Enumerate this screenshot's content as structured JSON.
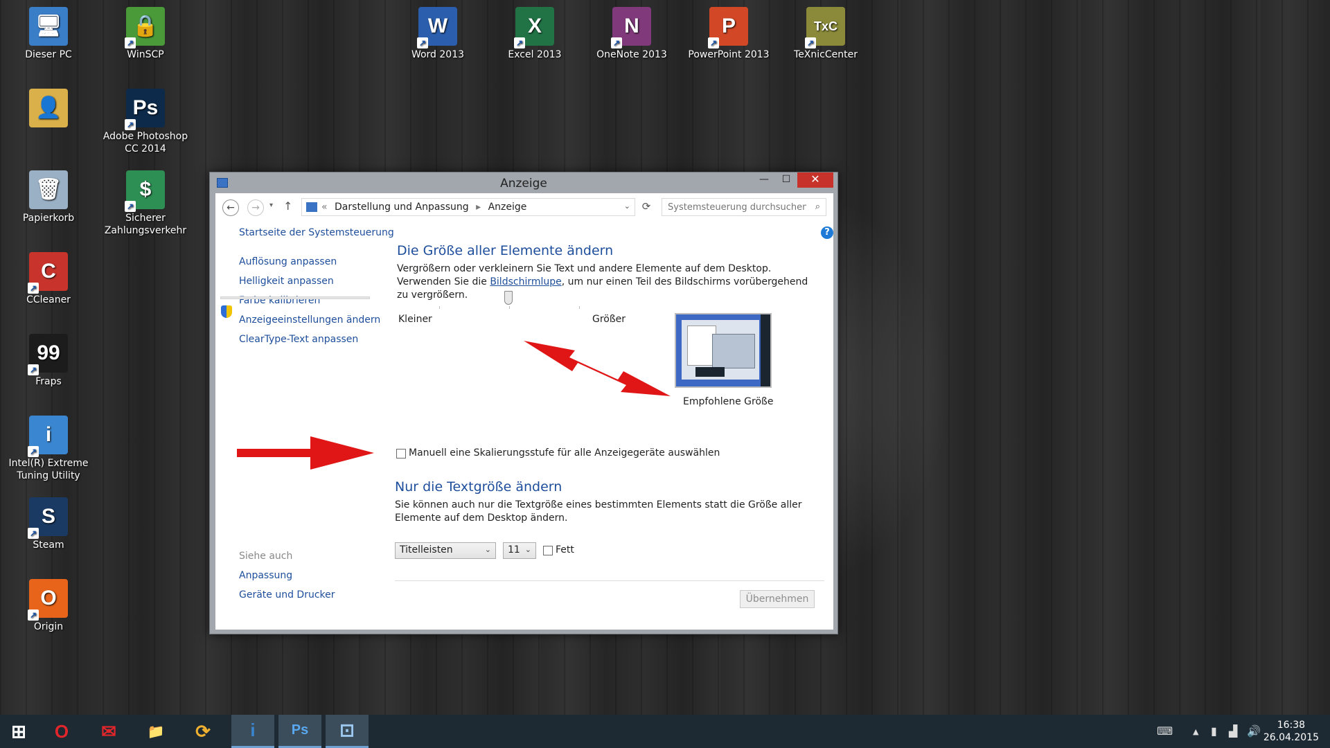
{
  "desktop": {
    "icons": [
      {
        "label": "Dieser PC",
        "glyph": "🖥",
        "color": "#3b7ec8"
      },
      {
        "label": "WinSCP",
        "glyph": "🔒",
        "color": "#4a9a3a"
      },
      {
        "label": "",
        "glyph": "👤",
        "color": "#d9b04a"
      },
      {
        "label": "Adobe Photoshop CC 2014",
        "glyph": "Ps",
        "color": "#0d2a4a"
      },
      {
        "label": "Papierkorb",
        "glyph": "🗑",
        "color": "#9ab0c4"
      },
      {
        "label": "Sicherer Zahlungsverkehr",
        "glyph": "$",
        "color": "#2e8f55"
      },
      {
        "label": "CCleaner",
        "glyph": "C",
        "color": "#c8342c"
      },
      {
        "label": "Fraps",
        "glyph": "99",
        "color": "#1c1c1c"
      },
      {
        "label": "Intel(R) Extreme Tuning Utility",
        "glyph": "i",
        "color": "#3a86d0"
      },
      {
        "label": "Steam",
        "glyph": "S",
        "color": "#1a3a64"
      },
      {
        "label": "Origin",
        "glyph": "O",
        "color": "#e8641a"
      },
      {
        "label": "Word 2013",
        "glyph": "W",
        "color": "#2b5fae"
      },
      {
        "label": "Excel 2013",
        "glyph": "X",
        "color": "#217346"
      },
      {
        "label": "OneNote 2013",
        "glyph": "N",
        "color": "#80397b"
      },
      {
        "label": "PowerPoint 2013",
        "glyph": "P",
        "color": "#d24726"
      },
      {
        "label": "TeXnicCenter",
        "glyph": "TxC",
        "color": "#8a8a3a"
      }
    ]
  },
  "window": {
    "title": "Anzeige",
    "minimize": "—",
    "maximize": "☐",
    "close": "✕",
    "address": {
      "recent": "▾",
      "up": "↑",
      "prefix": "«",
      "crumb1": "Darstellung und Anpassung",
      "crumb_sep": "▸",
      "crumb2": "Anzeige",
      "refresh": "⟳",
      "search_placeholder": "Systemsteuerung durchsuchen"
    },
    "sidebar": {
      "home": "Startseite der Systemsteuerung",
      "items": [
        "Auflösung anpassen",
        "Helligkeit anpassen",
        "Farbe kalibrieren",
        "Anzeigeeinstellungen ändern",
        "ClearType-Text anpassen"
      ],
      "see_also": "Siehe auch",
      "see_also_items": [
        "Anpassung",
        "Geräte und Drucker"
      ]
    },
    "main": {
      "heading1": "Die Größe aller Elemente ändern",
      "para1_a": "Vergrößern oder verkleinern Sie Text und andere Elemente auf dem Desktop. Verwenden Sie die",
      "para1_link": "Bildschirmlupe",
      "para1_b": ", um nur einen Teil des Bildschirms vorübergehend zu vergrößern.",
      "slider_small": "Kleiner",
      "slider_large": "Größer",
      "slider_value": 0.5,
      "preview_caption": "Empfohlene Größe",
      "manual_checkbox": "Manuell eine Skalierungsstufe für alle Anzeigegeräte auswählen",
      "heading2": "Nur die Textgröße ändern",
      "para2": "Sie können auch nur die Textgröße eines bestimmten Elements statt die Größe aller Elemente auf dem Desktop ändern.",
      "element_select": "Titelleisten",
      "size_select": "11",
      "bold_label": "Fett",
      "apply": "Übernehmen"
    }
  },
  "taskbar": {
    "items": [
      {
        "name": "start",
        "glyph": "⊞",
        "color": "#ffffff"
      },
      {
        "name": "opera",
        "glyph": "O",
        "color": "#e0262b"
      },
      {
        "name": "mail",
        "glyph": "✉",
        "color": "#e0262b"
      },
      {
        "name": "explorer",
        "glyph": "📁",
        "color": "#f2c44d"
      },
      {
        "name": "app-ring",
        "glyph": "⟳",
        "color": "#f0b030"
      },
      {
        "name": "intel-xtu",
        "glyph": "i",
        "color": "#3a86d0"
      },
      {
        "name": "photoshop",
        "glyph": "Ps",
        "color": "#5aa8f0"
      },
      {
        "name": "control-panel",
        "glyph": "⊡",
        "color": "#9cc8f0"
      }
    ],
    "tray": {
      "keyboard": "⌨",
      "show_hidden": "▲",
      "network1": "▮",
      "network2": "▟",
      "volume": "🔊"
    },
    "time": "16:38",
    "date": "26.04.2015"
  }
}
